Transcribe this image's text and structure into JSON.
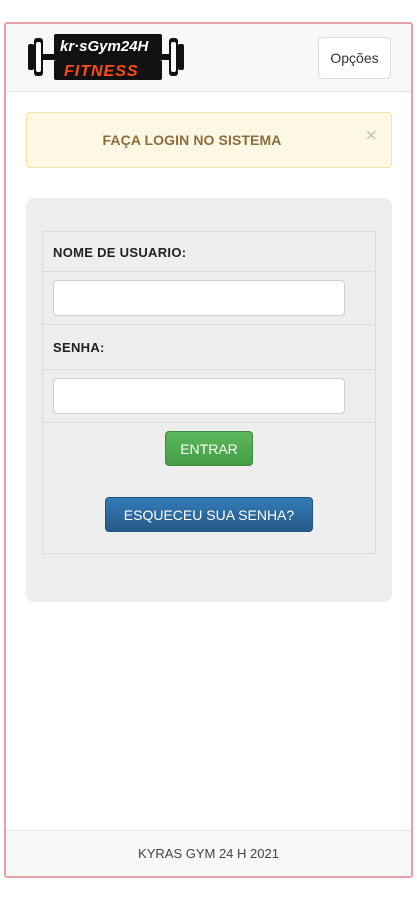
{
  "navbar": {
    "logo_top": "kr·sGym24H",
    "logo_bottom": "FITNESS",
    "options_label": "Opções"
  },
  "alert": {
    "message": "FAÇA LOGIN NO SISTEMA",
    "close_symbol": "×"
  },
  "form": {
    "username_label": "NOME DE USUARIO:",
    "username_value": "",
    "password_label": "SENHA:",
    "password_value": "",
    "submit_label": "ENTRAR",
    "forgot_label": "ESQUECEU SUA SENHA?"
  },
  "footer": {
    "text": "KYRAS GYM 24 H 2021"
  },
  "colors": {
    "accent_green": "#5cb85c",
    "accent_blue": "#337ab7",
    "alert_bg": "#fcf8e3",
    "logo_orange": "#ff4b12"
  }
}
